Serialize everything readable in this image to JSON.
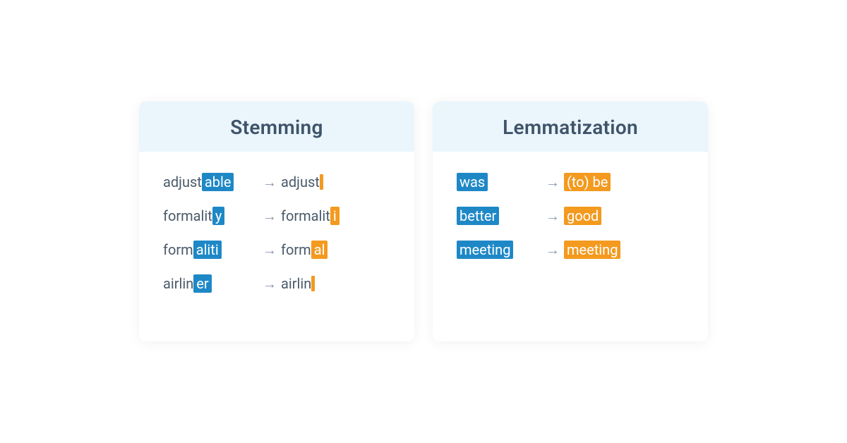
{
  "stemming": {
    "title": "Stemming",
    "rows": [
      {
        "left_pre": "adjust",
        "left_hl": "able",
        "right_pre": "adjust",
        "right_hl": "",
        "right_bar": true
      },
      {
        "left_pre": "formalit",
        "left_hl": "y",
        "right_pre": "formalit",
        "right_hl": "i",
        "right_bar": false
      },
      {
        "left_pre": "form",
        "left_hl": "aliti",
        "right_pre": "form",
        "right_hl": "al",
        "right_bar": false
      },
      {
        "left_pre": "airlin",
        "left_hl": "er",
        "right_pre": "airlin",
        "right_hl": "",
        "right_bar": true
      }
    ]
  },
  "lemmatization": {
    "title": "Lemmatization",
    "rows": [
      {
        "left_hl": "was",
        "right_hl": "(to) be"
      },
      {
        "left_hl": "better",
        "right_hl": "good"
      },
      {
        "left_hl": "meeting",
        "right_hl": "meeting"
      }
    ]
  },
  "arrow": "→"
}
